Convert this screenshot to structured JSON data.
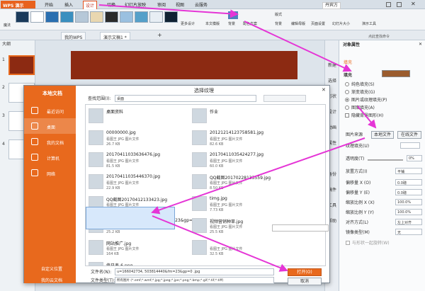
{
  "app": {
    "logo": "WPS 演示"
  },
  "menu": [
    "开始",
    "插入",
    "设计",
    "切换",
    "幻灯片放映",
    "审阅",
    "视图",
    "云服务"
  ],
  "user": "丹宾方",
  "ribbon": {
    "left_label": "魔法",
    "more_design": "更多设计",
    "design_buttons": [
      "本文模版"
    ],
    "background": "背景",
    "color_scheme": "配色方案",
    "style": "版式",
    "bg_style": "背景",
    "edit_master": "编辑母版",
    "page_setup": "页面设置",
    "slide_size": "幻灯片大小",
    "presenter_tools": "演示工具"
  },
  "tabs": [
    {
      "label": "我的WPS"
    },
    {
      "label": "演示文稿1 *"
    }
  ],
  "slide_panel": {
    "tab": "大纲",
    "slides": [
      "1",
      "2",
      "3",
      "4"
    ]
  },
  "side_toolbar": [
    "新建",
    "选择",
    "形状",
    "设计",
    "动画",
    "属性",
    "备份",
    "稿件",
    "工具",
    "帮助"
  ],
  "props": {
    "title": "对象属性",
    "tab": "填充",
    "section": "填充",
    "options": [
      "纯色填充(S)",
      "渐变填充(G)",
      "图片或纹理填充(P)",
      "图案填充(A)",
      "隐藏背景图形(H)"
    ],
    "source_label": "图片来源",
    "source_buttons": [
      "本地文件",
      "在线文件"
    ],
    "texture_label": "纹理填充(U)",
    "transparency_label": "透明度(T)",
    "transparency_value": "0%",
    "placement_label": "放置方式(I)",
    "placement_value": "平铺",
    "offset_x_label": "偏移量 X (O)",
    "offset_x": "0.0磅",
    "offset_y_label": "偏移量 Y (E)",
    "offset_y": "0.0磅",
    "scale_x_label": "缩放比例 X (X)",
    "scale_x": "100.0%",
    "scale_y_label": "缩放比例 Y (Y)",
    "scale_y": "100.0%",
    "align_label": "对齐方式(L)",
    "align_value": "左上对齐",
    "mirror_label": "镜像类型(M)",
    "mirror_value": "无",
    "rotate_label": "与形状一起旋转(W)",
    "right_top": "点此查找命令"
  },
  "dialog": {
    "title": "选择纹理",
    "sidebar": [
      "本地文档",
      "最近访问",
      "桌面",
      "我的文档",
      "计算机",
      "网络"
    ],
    "sidebar_bottom": [
      "自定义位置",
      "我的云文档"
    ],
    "lookin_label": "查找范围(I):",
    "lookin_value": "桌面",
    "files_col1": [
      {
        "name": "桌面资料",
        "type": "",
        "size": ""
      },
      {
        "name": "00000000.jpg",
        "type": "看图王 JPG 图片文件",
        "size": "26.7 KB"
      },
      {
        "name": "20170411033636476.jpg",
        "type": "看图王 JPG 图片文件",
        "size": "81.5 KB"
      },
      {
        "name": "20170411035446370.jpg",
        "type": "看图王 JPG 图片文件",
        "size": "22.9 KB"
      },
      {
        "name": "QQ截图20170412133423.jpg",
        "type": "看图王 JPG 图片文件",
        "size": "18.6 KB"
      },
      {
        "name": "u=166042734,503814440&fm=23&gp=0.jpg",
        "type": "看图王 JPG 图片文件",
        "size": "25.2 KB"
      },
      {
        "name": "网站推广.jpg",
        "type": "看图王 JPG 图片文件",
        "size": "164 KB"
      },
      {
        "name": "值日表-6.png",
        "type": "看图王 PNG 图片文件",
        "size": "18.2 KB"
      }
    ],
    "files_col2": [
      {
        "name": "作业",
        "type": "",
        "size": ""
      },
      {
        "name": "20121214123758581.jpg",
        "type": "看图王 JPG 图片文件",
        "size": "82.6 KB"
      },
      {
        "name": "20170411035424277.jpg",
        "type": "看图王 JPG 图片文件",
        "size": "60.0 KB"
      },
      {
        "name": "QQ截图20170228133559.jpg",
        "type": "看图王 JPG 图片文件",
        "size": "8.50 KB"
      },
      {
        "name": "timg.jpg",
        "type": "看图王 JPG 图片文件",
        "size": "7.73 KB"
      },
      {
        "name": "视频营销种草.jpg",
        "type": "看图王 JPG 图片文件",
        "size": "25.5 KB"
      },
      {
        "name": "",
        "type": "看图王 JPG 图片文件",
        "size": "32.5 KB"
      }
    ],
    "filename_label": "文件名(N):",
    "filename_value": "u=166042734, 503814440&fm=23&gp=0 .jpg",
    "filetype_label": "文件类型(T):",
    "filetype_value": "所有图片 (*.emf;*.wmf;*.jpg;*.jpeg;*.jpe;*.png;*.bmp;*.gif;*.tif;*.tiff)",
    "open": "打开(O)",
    "cancel": "取消"
  },
  "colors": {
    "accent": "#e8691d",
    "arrow": "#e535d6"
  }
}
